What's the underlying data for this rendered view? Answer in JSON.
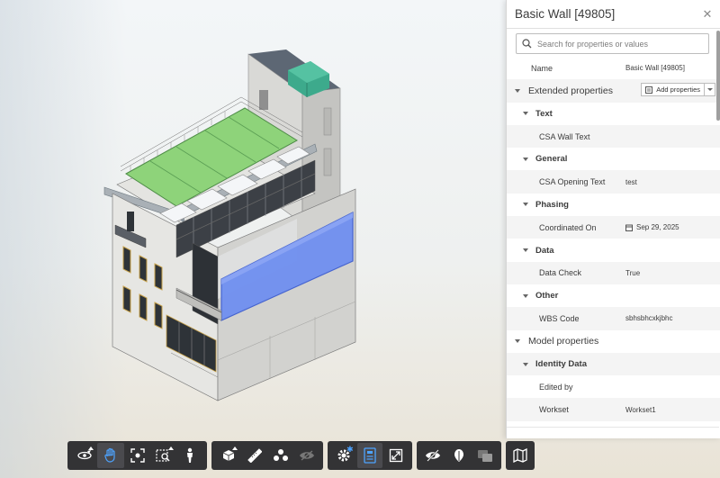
{
  "panel": {
    "title": "Basic Wall [49805]",
    "search_placeholder": "Search for properties or values",
    "name_label": "Name",
    "name_value": "Basic Wall [49805]",
    "extended_section": "Extended properties",
    "add_properties_label": "Add properties",
    "groups": {
      "text": "Text",
      "general": "General",
      "phasing": "Phasing",
      "data": "Data",
      "other": "Other",
      "identity": "Identity Data"
    },
    "props": {
      "csa_wall_text_label": "CSA Wall Text",
      "csa_wall_text_value": "",
      "csa_opening_text_label": "CSA Opening Text",
      "csa_opening_text_value": "test",
      "coordinated_on_label": "Coordinated On",
      "coordinated_on_value": "Sep 29, 2025",
      "data_check_label": "Data Check",
      "data_check_value": "True",
      "wbs_code_label": "WBS Code",
      "wbs_code_value": "sbhsbhcxkjbhc",
      "edited_by_label": "Edited by",
      "edited_by_value": "",
      "workset_label": "Workset",
      "workset_value": "Workset1"
    },
    "model_section": "Model properties"
  },
  "toolbar": {
    "groups": [
      [
        "orbit-icon",
        "pan-icon",
        "fit-view-icon",
        "zoom-window-icon",
        "first-person-icon"
      ],
      [
        "section-box-icon",
        "measure-icon",
        "explode-icon",
        "hide-icon"
      ],
      [
        "settings-icon",
        "properties-icon",
        "fullscreen-icon"
      ],
      [
        "visibility-icon",
        "model-browser-icon",
        "issues-icon"
      ],
      [
        "sheets-icon"
      ]
    ],
    "active": "pan-icon"
  },
  "colors": {
    "toolbar_bg": "#333335",
    "accent_blue": "#4da3ff",
    "roof_green": "#8ed37a",
    "selection_blue": "#6f8ff0",
    "hvac_teal": "#3daa8c"
  }
}
